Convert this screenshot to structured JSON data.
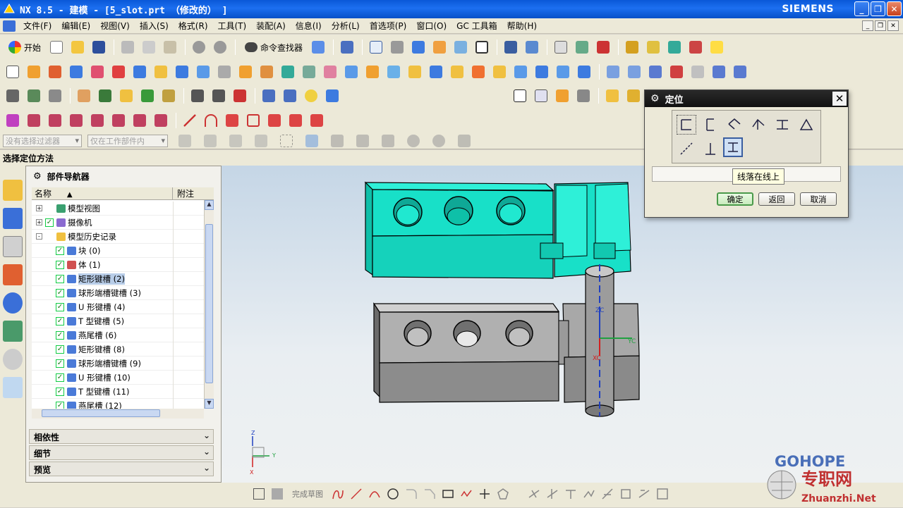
{
  "app": {
    "title": "NX 8.5 - 建模 - [5_slot.prt （修改的） ]",
    "brand": "SIEMENS"
  },
  "menu": [
    "文件(F)",
    "编辑(E)",
    "视图(V)",
    "插入(S)",
    "格式(R)",
    "工具(T)",
    "装配(A)",
    "信息(I)",
    "分析(L)",
    "首选项(P)",
    "窗口(O)",
    "GC 工具箱",
    "帮助(H)"
  ],
  "toolbar": {
    "start_label": "开始",
    "command_finder_label": "命令查找器"
  },
  "filters": {
    "type_filter": "没有选择过滤器",
    "scope_filter": "仅在工作部件内"
  },
  "status_prompt": "选择定位方法",
  "navigator": {
    "title": "部件导航器",
    "col_name": "名称",
    "col_note": "附注",
    "nodes": [
      {
        "label": "模型视图",
        "level": 0,
        "expand": "+",
        "checked": false
      },
      {
        "label": "摄像机",
        "level": 0,
        "expand": "+",
        "checked": true
      },
      {
        "label": "模型历史记录",
        "level": 0,
        "expand": "-",
        "checked": false
      },
      {
        "label": "块 (0)",
        "level": 1,
        "checked": true
      },
      {
        "label": "体 (1)",
        "level": 1,
        "checked": true
      },
      {
        "label": "矩形键槽 (2)",
        "level": 1,
        "checked": true,
        "selected": true
      },
      {
        "label": "球形端槽键槽 (3)",
        "level": 1,
        "checked": true
      },
      {
        "label": "U 形键槽 (4)",
        "level": 1,
        "checked": true
      },
      {
        "label": "T 型键槽 (5)",
        "level": 1,
        "checked": true
      },
      {
        "label": "燕尾槽 (6)",
        "level": 1,
        "checked": true
      },
      {
        "label": "矩形键槽 (8)",
        "level": 1,
        "checked": true
      },
      {
        "label": "球形端槽键槽 (9)",
        "level": 1,
        "checked": true
      },
      {
        "label": "U 形键槽 (10)",
        "level": 1,
        "checked": true
      },
      {
        "label": "T 型键槽 (11)",
        "level": 1,
        "checked": true
      },
      {
        "label": "燕尾槽 (12)",
        "level": 1,
        "checked": true
      }
    ],
    "sections": [
      "相依性",
      "细节",
      "预览"
    ]
  },
  "dialog": {
    "title": "定位",
    "tooltip": "线落在线上",
    "ok_label": "确定",
    "back_label": "返回",
    "cancel_label": "取消"
  },
  "viewport": {
    "axis_zc": "ZC",
    "axis_yc": "YC",
    "axis_xc": "XC",
    "triad_z": "Z",
    "triad_y": "Y",
    "triad_x": "X"
  },
  "sketch_bar": {
    "finish_label": "完成草图"
  },
  "watermark": {
    "brand": "GOHOPE",
    "cn": "专职网",
    "url": "Zhuanzhi.Net"
  },
  "colors": {
    "part_cyan": "#18e0c8",
    "part_gray": "#a8a8a8",
    "title_blue": "#0a58d8"
  }
}
